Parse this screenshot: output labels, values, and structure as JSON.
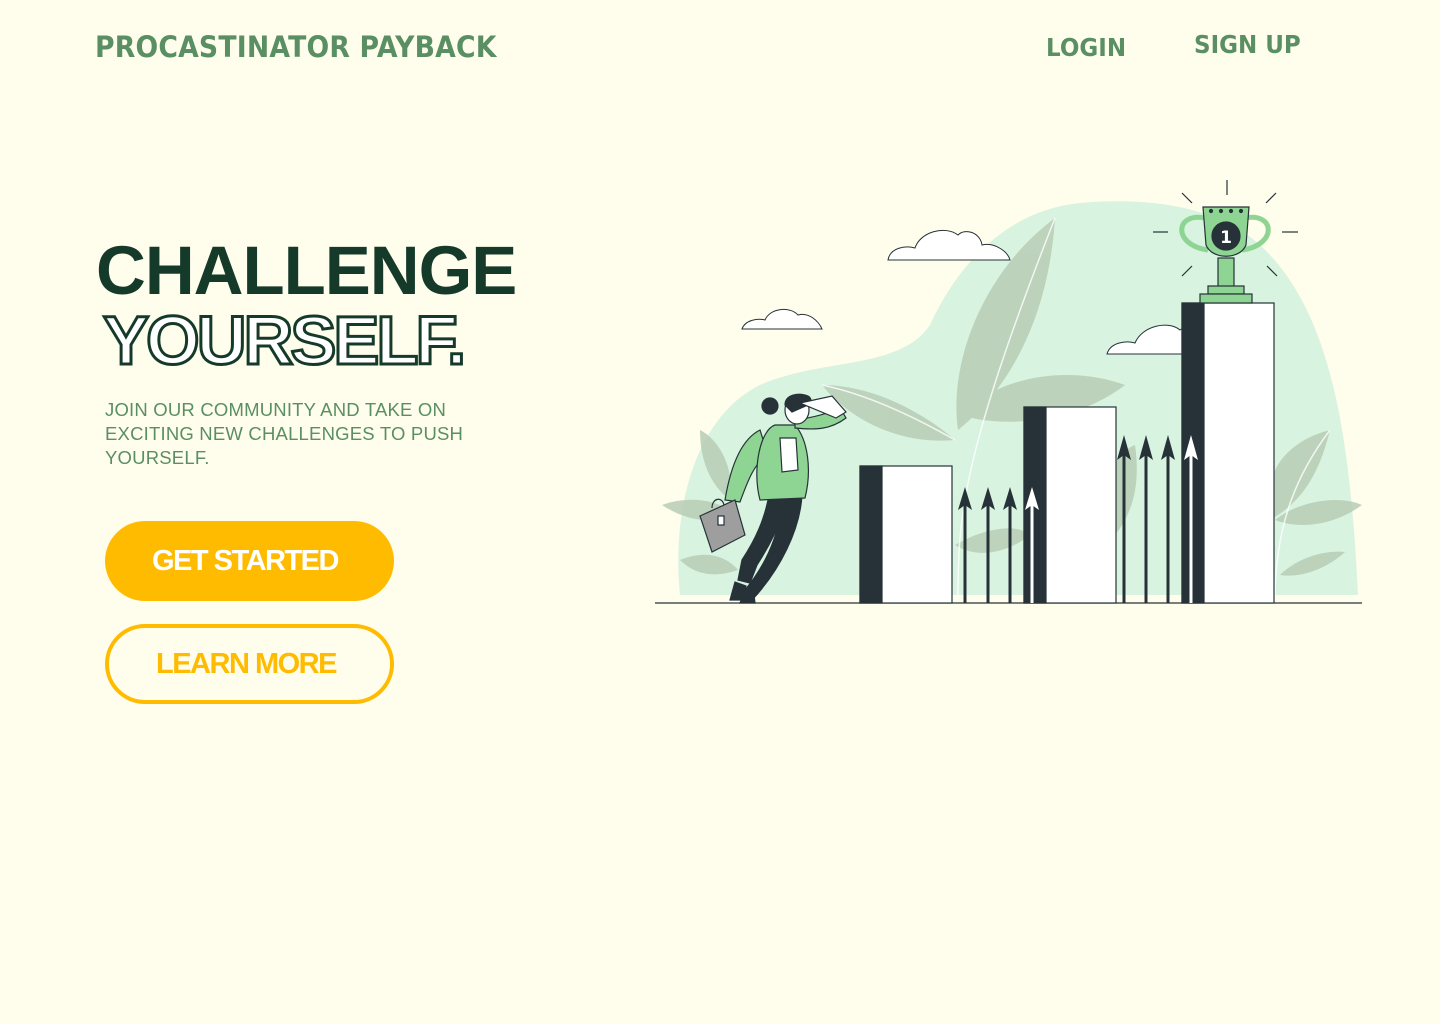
{
  "header": {
    "brand": "PROCASTINATOR PAYBACK",
    "nav": {
      "login": "LOGIN",
      "signup": "SIGN UP"
    }
  },
  "hero": {
    "headline_line1": "CHALLENGE",
    "headline_line2": "YOURSELF.",
    "tagline": "JOIN OUR COMMUNITY AND TAKE ON EXCITING NEW CHALLENGES TO PUSH YOURSELF.",
    "primary_button": "GET STARTED",
    "secondary_button": "LEARN MORE"
  },
  "illustration": {
    "trophy_rank": "1",
    "icons": [
      "cloud-icon",
      "leaf-icon",
      "arrow-up-icon",
      "trophy-icon",
      "briefcase-icon"
    ]
  },
  "colors": {
    "background": "#fffdec",
    "brand_green": "#5a8f63",
    "headline_dark": "#153a2a",
    "accent_yellow": "#ffbb00",
    "mint": "#d8f3e0",
    "bar_dark": "#263238",
    "figure_green": "#8ed492"
  }
}
